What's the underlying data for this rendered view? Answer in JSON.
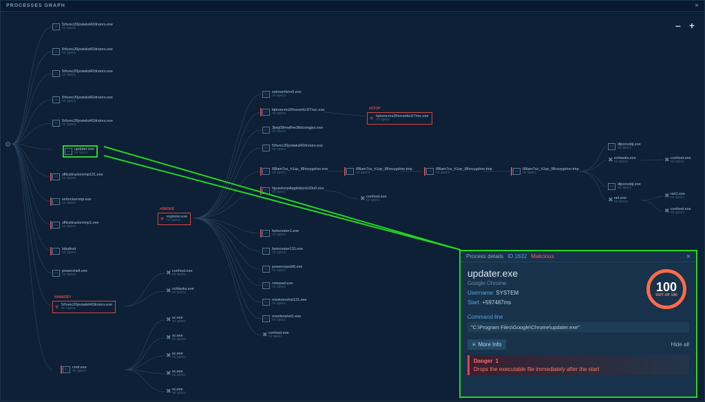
{
  "window": {
    "title": "PROCESSES GRAPH"
  },
  "zoom": {
    "minus": "–",
    "plus": "+"
  },
  "sub_default": "no specs",
  "nodes": {
    "root_gear": "⚙",
    "col1": [
      {
        "name": "5rfurec20jxsiwkd42drsiors.exe"
      },
      {
        "name": "5rfurec20jxsiwkd42drsiors.exe"
      },
      {
        "name": "5rfurec20jxsiwkd42drsiors.exe"
      },
      {
        "name": "5rfurec20jxsiwkd42drsiors.exe"
      },
      {
        "name": "5rfurec20jxsiwkd42drsiors.exe"
      }
    ],
    "updater": {
      "name": "updater.exe"
    },
    "col1b": [
      {
        "name": "sfficsitrackerrmp131.exe"
      },
      {
        "name": "wrtrnckerrmp.exe"
      },
      {
        "name": "sfficsitrackerrmp1.exe"
      },
      {
        "name": "lsbultnst"
      },
      {
        "name": "powershell.exe"
      }
    ],
    "amadey": {
      "tag": "#AMADEY",
      "name": "5rfurec20jxsiwkd42drsiors.exe"
    },
    "cmd": {
      "name": "cmd.exe"
    },
    "smoke": {
      "tag": "#SMOKE",
      "name": "explorer.exe"
    },
    "col2tools": [
      "conhost.exe",
      "schtasks.exe",
      "sc.exe",
      "sc.exe",
      "sc.exe",
      "sc.exe",
      "sc.exe"
    ],
    "col3": [
      "sstreamlsnv5.exe",
      "lqteoocms2thovsriks1f7nsc.exe",
      "3jwg08mwlfne3tldcowgjez.exe",
      "5rfurec20jxsiwkd42drsiors.exe",
      "68lam7sz_h1qv_I8hsvygsher.exe",
      "hjyuiskorpAqgtIdzjvck20u0.exe",
      "fartxcoster1.exe",
      "fartxcoster131.exe",
      "powersxpobl6.exe",
      "notepad.exe",
      "msskoershst131.exe",
      "msoilsnshel1.exe",
      "conhost.exe"
    ],
    "stop": {
      "tag": "#STOP",
      "name": "lqteoocms2thovsriks1f7nsc.exe"
    },
    "chain": [
      "68lam7sz_h1qv_I8hsvygsher.tmp",
      "68lam7sz_h1qv_I8hsvygsher.tmp",
      "68lam7sz_h1qv_I8hsvygsher.tmp"
    ],
    "conhost_mid": "conhost.exe",
    "rightcol": [
      "dlporsxlql.exe",
      "schtasks.exe",
      "dlporsxlql.exe",
      "net.exe"
    ],
    "rightcol2": [
      "conhost.exe",
      "net1.exe",
      "conhost.exe"
    ]
  },
  "detail": {
    "header_label": "Process details",
    "id": "ID 1632",
    "malicious": "Malicious",
    "process_name": "updater.exe",
    "company": "Google Chrome",
    "username_label": "Username:",
    "username_value": "SYSTEM",
    "start_label": "Start:",
    "start_value": "+597487ms",
    "score": "100",
    "score_label": "OUT OF 100",
    "cmdline_label": "Command line",
    "cmdline_value": "\"C:\\Program Files\\Google\\Chrome\\updater.exe\"",
    "more_info": "More Info",
    "hide_all": "Hide all",
    "danger_label": "Danger",
    "danger_count": "1",
    "danger_desc": "Drops the executable file immediately after the start"
  }
}
